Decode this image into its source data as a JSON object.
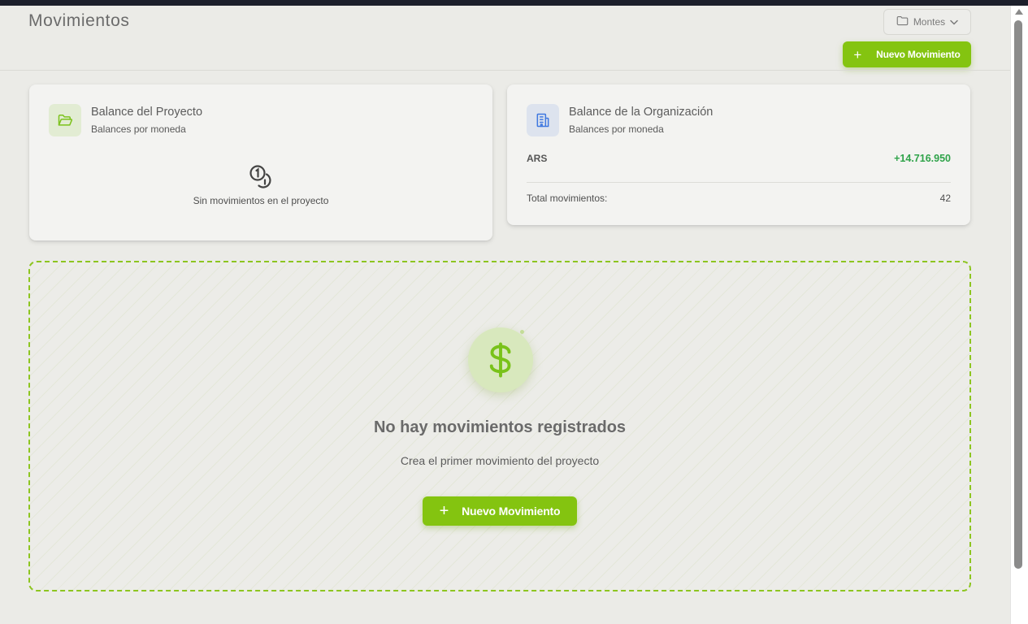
{
  "header": {
    "title": "Movimientos",
    "project_selector": {
      "selected": "Montes",
      "icon": "folder-icon"
    },
    "new_button_label": "Nuevo Movimiento"
  },
  "project_card": {
    "title": "Balance del Proyecto",
    "subtitle": "Balances por moneda",
    "icon": "folder-open-icon",
    "empty_text": "Sin movimientos en el proyecto"
  },
  "org_card": {
    "title": "Balance de la Organización",
    "subtitle": "Balances por moneda",
    "icon": "building-icon",
    "balances": [
      {
        "currency": "ARS",
        "value": "+14.716.950"
      }
    ],
    "total_label": "Total movimientos:",
    "total_value": "42"
  },
  "empty_state": {
    "title": "No hay movimientos registrados",
    "subtitle": "Crea el primer movimiento del proyecto",
    "button_label": "Nuevo Movimiento",
    "icon": "dollar-icon"
  },
  "colors": {
    "accent": "#84c410",
    "positive": "#2fa34a",
    "background": "#ebebe7"
  }
}
